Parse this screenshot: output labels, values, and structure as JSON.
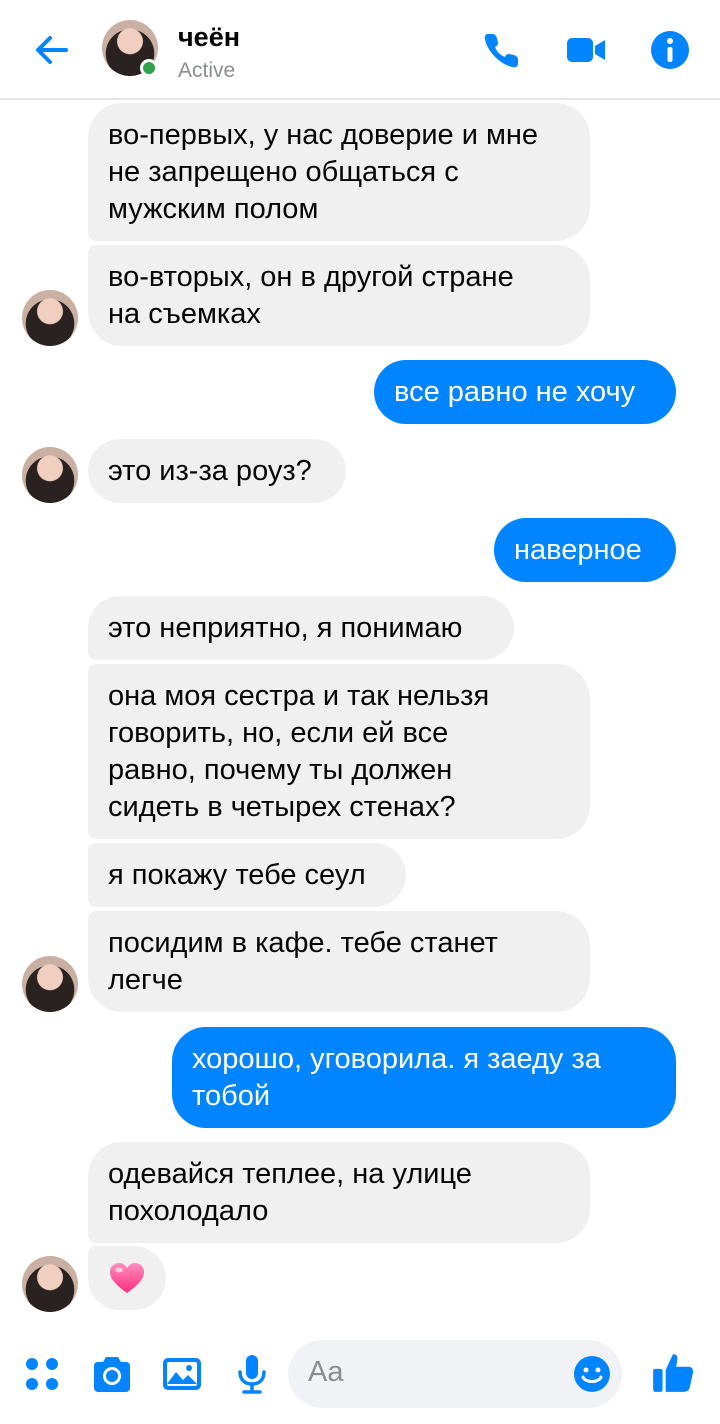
{
  "header": {
    "name": "чеён",
    "status": "Active"
  },
  "messages": [
    {
      "side": "in",
      "text": "во-первых, у нас доверие и мне не запрещено общаться с мужским полом",
      "lines": [
        "во-первых, у нас доверие и мне",
        "не запрещено общаться с",
        "мужским полом"
      ]
    },
    {
      "side": "in",
      "text": "во-вторых, он в другой стране на съемках",
      "lines": [
        "во-вторых, он в другой стране",
        "на съемках"
      ]
    },
    {
      "side": "out",
      "text": "все равно не хочу",
      "lines": [
        "все равно не хочу"
      ]
    },
    {
      "side": "in",
      "text": "это из-за роуз?",
      "lines": [
        "это из-за роуз?"
      ]
    },
    {
      "side": "out",
      "text": "наверное",
      "lines": [
        "наверное"
      ]
    },
    {
      "side": "in",
      "text": "это неприятно, я понимаю",
      "lines": [
        "это неприятно, я понимаю"
      ]
    },
    {
      "side": "in",
      "text": "она моя сестра и так нельзя говорить, но, если ей все равно, почему ты должен сидеть в четырех стенах?",
      "lines": [
        "она моя сестра и так нельзя",
        "говорить, но, если ей все",
        "равно, почему ты должен",
        "сидеть в четырех стенах?"
      ]
    },
    {
      "side": "in",
      "text": "я покажу тебе сеул",
      "lines": [
        "я покажу тебе сеул"
      ]
    },
    {
      "side": "in",
      "text": "посидим в кафе. тебе станет легче",
      "lines": [
        "посидим в кафе. тебе станет",
        "легче"
      ]
    },
    {
      "side": "out",
      "text": "хорошо, уговорила. я заеду за тобой",
      "lines": [
        "хорошо, уговорила. я заеду за",
        "тобой"
      ]
    },
    {
      "side": "in",
      "text": "одевайся теплее, на улице похолодало",
      "lines": [
        "одевайся теплее, на улице",
        "похолодало"
      ]
    }
  ],
  "reaction": {
    "icon": "heart-emoji"
  },
  "composer": {
    "placeholder": "Aa"
  },
  "colors": {
    "accent": "#0084ff",
    "incoming_bubble": "#f0f0f0",
    "active_dot": "#31a24c"
  }
}
